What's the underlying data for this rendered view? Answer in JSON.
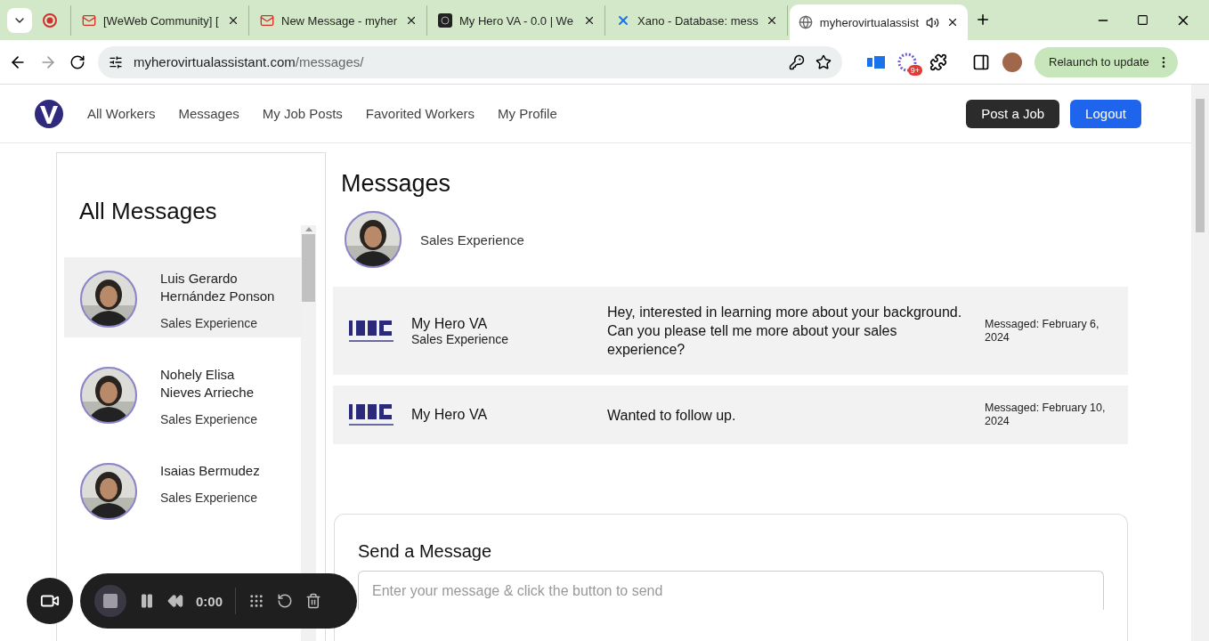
{
  "browser": {
    "tabs": [
      {
        "kind": "record",
        "selected": false
      },
      {
        "label": "[WeWeb Community] [",
        "kind": "mail",
        "selected": false
      },
      {
        "label": "New Message - myher",
        "kind": "mail",
        "selected": false
      },
      {
        "label": "My Hero VA - 0.0 | We",
        "kind": "app",
        "selected": false
      },
      {
        "label": "Xano - Database: mess",
        "kind": "xano",
        "selected": false
      },
      {
        "label": "myherovirtualassist",
        "kind": "globe",
        "selected": true
      }
    ],
    "url_host": "myherovirtualassistant.com",
    "url_path": "/messages/",
    "badge": "9+",
    "relaunch": "Relaunch to update"
  },
  "nav": {
    "links": [
      "All Workers",
      "Messages",
      "My Job Posts",
      "Favorited Workers",
      "My Profile"
    ],
    "post_button": "Post a Job",
    "logout_button": "Logout"
  },
  "sidebar": {
    "title": "All Messages",
    "items": [
      {
        "name": "Luis Gerardo Hernández Ponson",
        "tagline": "Sales Experience",
        "selected": true
      },
      {
        "name": "Nohely Elisa Nieves Arrieche",
        "tagline": "Sales Experience",
        "selected": false
      },
      {
        "name": "Isaias Bermudez",
        "tagline": "Sales Experience",
        "selected": false
      }
    ]
  },
  "main": {
    "title": "Messages",
    "header_tagline": "Sales Experience",
    "messages": [
      {
        "sender": "My Hero VA",
        "tagline": "Sales Experience",
        "text": "Hey, interested in learning more about your background. Can you please tell me more about your sales experience?",
        "date": "Messaged: February 6, 2024"
      },
      {
        "sender": "My Hero VA",
        "text": "Wanted to follow up.",
        "date": "Messaged: February 10, 2024"
      }
    ],
    "compose": {
      "title": "Send a Message",
      "placeholder": "Enter your message & click the button to send"
    }
  },
  "recorder": {
    "time": "0:00"
  }
}
